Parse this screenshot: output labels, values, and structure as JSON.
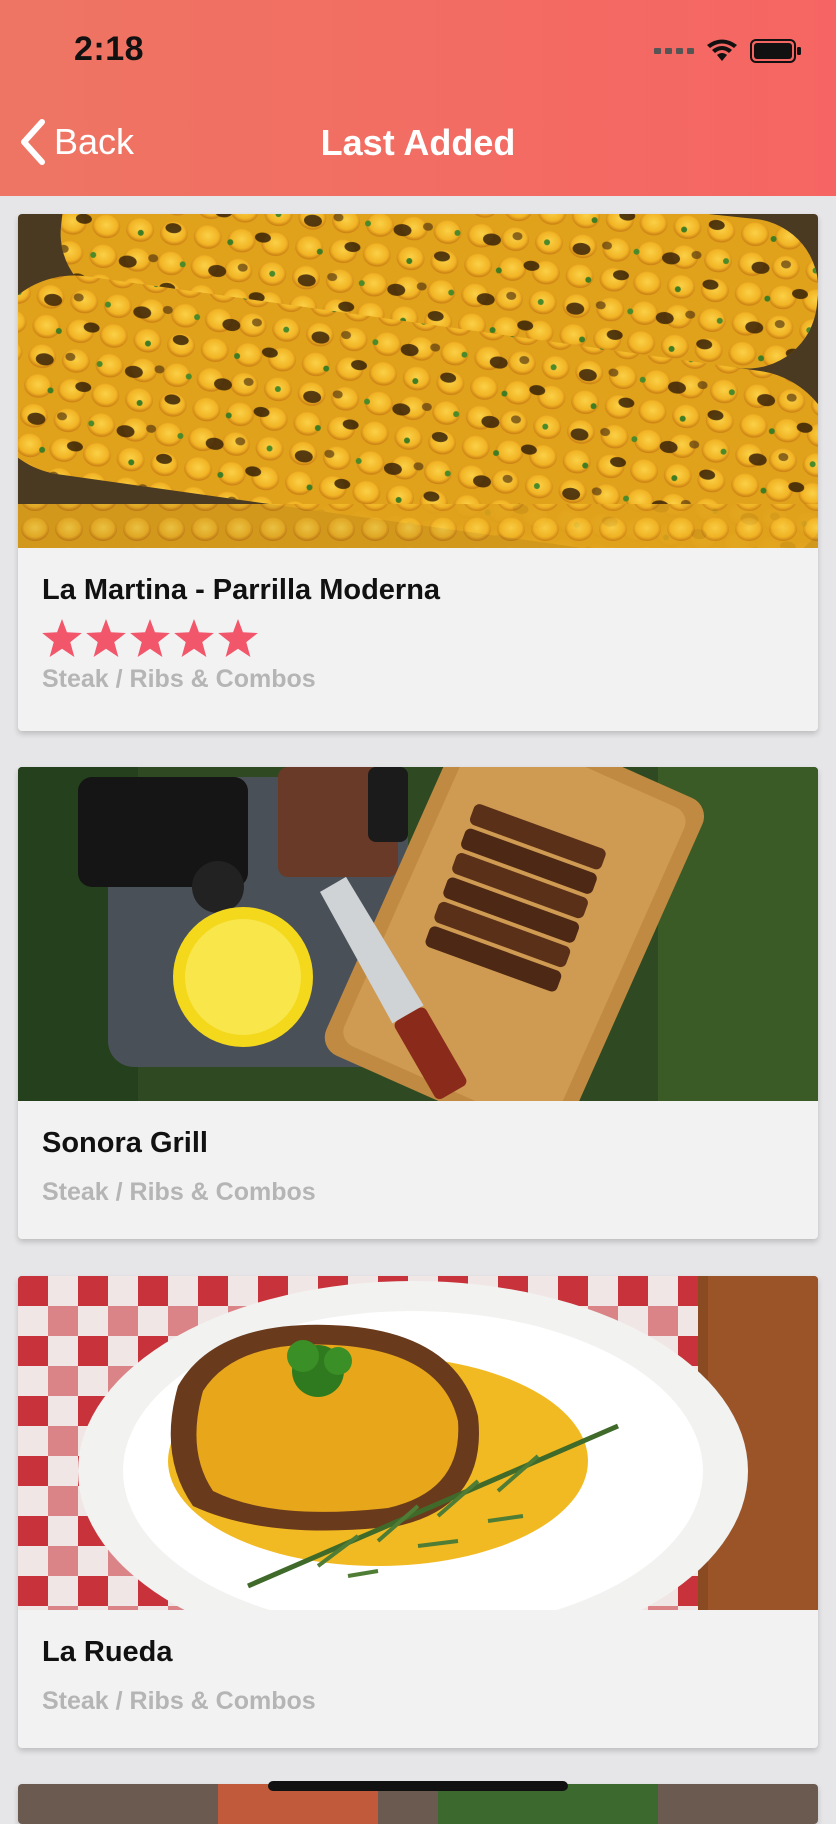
{
  "status_bar": {
    "time": "2:18"
  },
  "header": {
    "back_label": "Back",
    "title": "Last Added"
  },
  "restaurants": [
    {
      "name": "La Martina - Parrilla Moderna",
      "category": "Steak / Ribs & Combos",
      "rating": 5,
      "image": "grilled-corn"
    },
    {
      "name": "Sonora Grill",
      "category": "Steak / Ribs & Combos",
      "image": "steak-on-board"
    },
    {
      "name": "La Rueda",
      "category": "Steak / Ribs & Combos",
      "image": "plated-steak"
    }
  ],
  "colors": {
    "header_gradient_start": "#ee7563",
    "header_gradient_end": "#f66563",
    "star": "#f2566a",
    "category_text": "#b5b5b5"
  }
}
